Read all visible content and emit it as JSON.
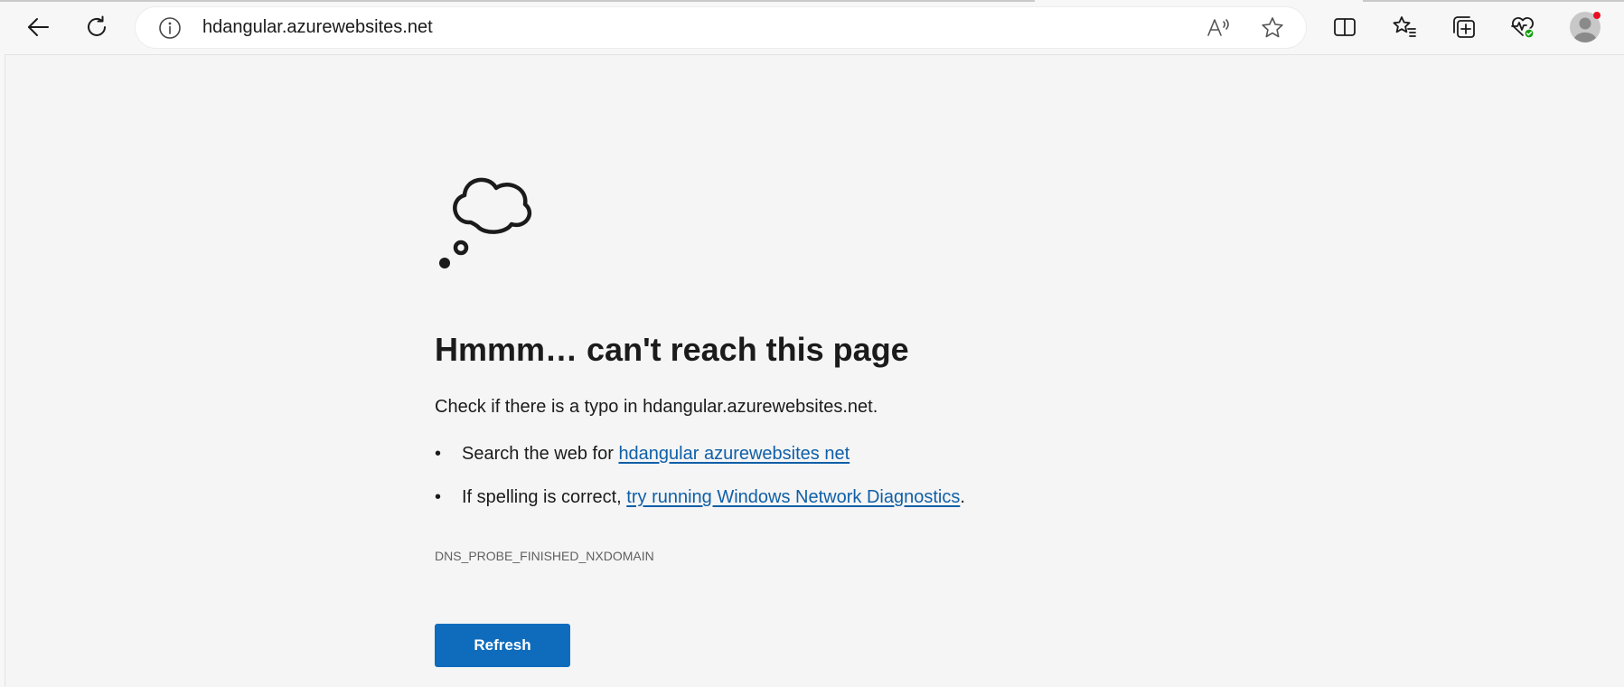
{
  "browser": {
    "url": "hdangular.azurewebsites.net",
    "icons": {
      "back": "back-arrow-icon",
      "refresh": "refresh-icon",
      "site_info": "info-icon",
      "read_aloud": "read-aloud-icon",
      "favorite": "star-icon",
      "split_screen": "split-screen-icon",
      "favorites": "favorites-icon",
      "collections": "collections-icon",
      "browser_essentials": "heart-pulse-icon",
      "profile": "avatar-icon"
    },
    "colors": {
      "toolbar_bg": "#f7f7f7",
      "address_bg": "#ffffff",
      "profile_notification": "#e81123",
      "essentials_ok": "#13a10e"
    }
  },
  "error_page": {
    "title": "Hmmm… can't reach this page",
    "message": "Check if there is a typo in hdangular.azurewebsites.net.",
    "suggestions": [
      {
        "bullet": "•",
        "prefix": "Search the web for ",
        "link": "hdangular azurewebsites net",
        "suffix": ""
      },
      {
        "bullet": "•",
        "prefix": "If spelling is correct, ",
        "link": "try running Windows Network Diagnostics",
        "suffix": "."
      }
    ],
    "error_code": "DNS_PROBE_FINISHED_NXDOMAIN",
    "refresh_label": "Refresh",
    "illustration": "thought-bubble-icon",
    "colors": {
      "link": "#0f5fa8",
      "button": "#0f6cbd",
      "page_bg": "#f5f5f5"
    }
  }
}
